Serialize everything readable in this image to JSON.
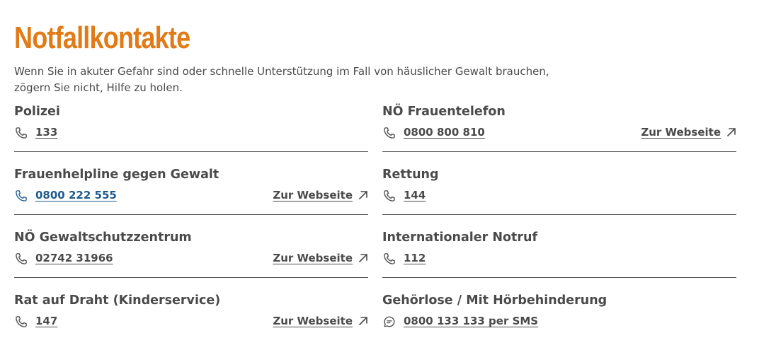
{
  "page": {
    "title": "Notfallkontakte",
    "intro": "Wenn Sie in akuter Gefahr sind oder schnelle Unterstützung im Fall von häuslicher Gewalt brauchen, zögern Sie nicht, Hilfe zu holen."
  },
  "colors": {
    "accent": "#e07b17",
    "text": "#4a4a4a",
    "link_active": "#1e5b8c"
  },
  "contacts": [
    {
      "title": "Polizei",
      "icon": "phone-icon",
      "value": "133",
      "website_label": ""
    },
    {
      "title": "NÖ Frauentelefon",
      "icon": "phone-icon",
      "value": "0800 800 810",
      "website_label": "Zur Webseite"
    },
    {
      "title": "Frauenhelpline gegen Gewalt",
      "icon": "phone-icon",
      "value": "0800 222 555",
      "website_label": "Zur Webseite"
    },
    {
      "title": "Rettung",
      "icon": "phone-icon",
      "value": "144",
      "website_label": ""
    },
    {
      "title": "NÖ Gewaltschutzzentrum",
      "icon": "phone-icon",
      "value": "02742 31966",
      "website_label": "Zur Webseite"
    },
    {
      "title": "Internationaler Notruf",
      "icon": "phone-icon",
      "value": "112",
      "website_label": ""
    },
    {
      "title": "Rat auf Draht (Kinderservice)",
      "icon": "phone-icon",
      "value": "147",
      "website_label": "Zur Webseite"
    },
    {
      "title": "Gehörlose / Mit Hörbehinderung",
      "icon": "chat-icon",
      "value": "0800 133 133 per SMS",
      "website_label": ""
    }
  ]
}
